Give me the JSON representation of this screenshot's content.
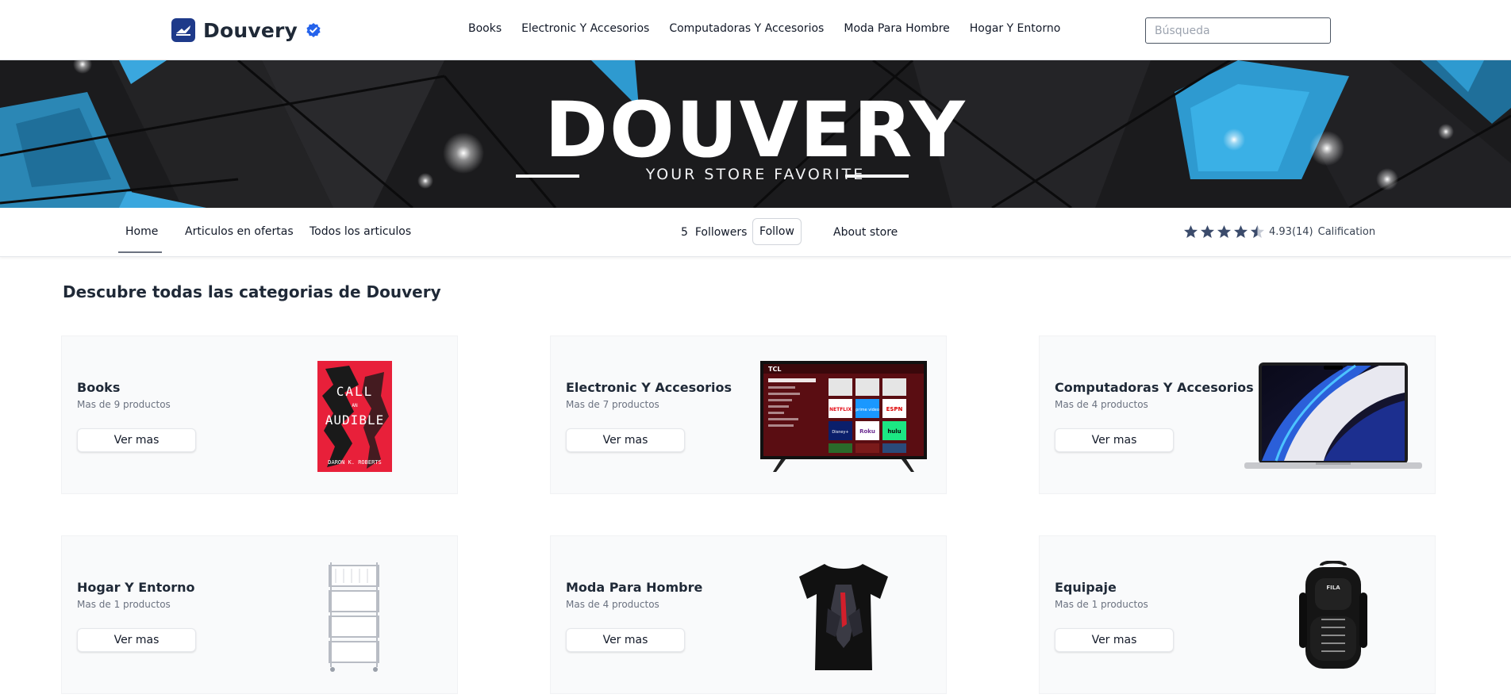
{
  "header": {
    "brand_name": "Douvery",
    "nav": [
      "Books",
      "Electronic Y Accesorios",
      "Computadoras Y Accesorios",
      "Moda Para Hombre",
      "Hogar Y Entorno"
    ],
    "search_placeholder": "Búsqueda"
  },
  "banner": {
    "title": "DOUVERY",
    "subtitle": "YOUR STORE FAVORITE"
  },
  "store_bar": {
    "tabs": [
      "Home",
      "Articulos en ofertas",
      "Todos los articulos"
    ],
    "active_tab": "Home",
    "followers_count": "5",
    "followers_label": "Followers",
    "follow_label": "Follow",
    "about_label": "About store",
    "rating_value": "4.93(14)",
    "rating_stars": 4.93,
    "rating_label": "Calification"
  },
  "main": {
    "section_title": "Descubre todas las categorias de Douvery",
    "button_label": "Ver mas",
    "categories": [
      {
        "name": "Books",
        "count": "Mas de 9 productos",
        "image": "book-cover-call-an-audible"
      },
      {
        "name": "Electronic Y Accesorios",
        "count": "Mas de 7 productos",
        "image": "tcl-roku-tv"
      },
      {
        "name": "Computadoras Y Accesorios",
        "count": "Mas de 4 productos",
        "image": "macbook-pro-laptop"
      },
      {
        "name": "Hogar Y Entorno",
        "count": "Mas de 1 productos",
        "image": "white-rolling-cart"
      },
      {
        "name": "Moda Para Hombre",
        "count": "Mas de 4 productos",
        "image": "black-graphic-tshirt"
      },
      {
        "name": "Equipaje",
        "count": "Mas de 1 productos",
        "image": "fila-black-backpack"
      }
    ],
    "book_cover_text": [
      "CALL",
      "AN",
      "AUDIBLE",
      "DARON K. ROBERTS"
    ],
    "tv_brand_text": "TCL",
    "tv_tiles": [
      "NETFLIX",
      "prime video",
      "ESPN",
      "Disney+",
      "Roku",
      "hulu"
    ],
    "backpack_brand_text": "FILA"
  },
  "colors": {
    "brand_blue": "#1e3a8a",
    "verified_blue": "#2563eb",
    "banner_bg": "#1b1b1d",
    "banner_accent": "#2e9ad0",
    "card_bg": "#f9fafb"
  }
}
